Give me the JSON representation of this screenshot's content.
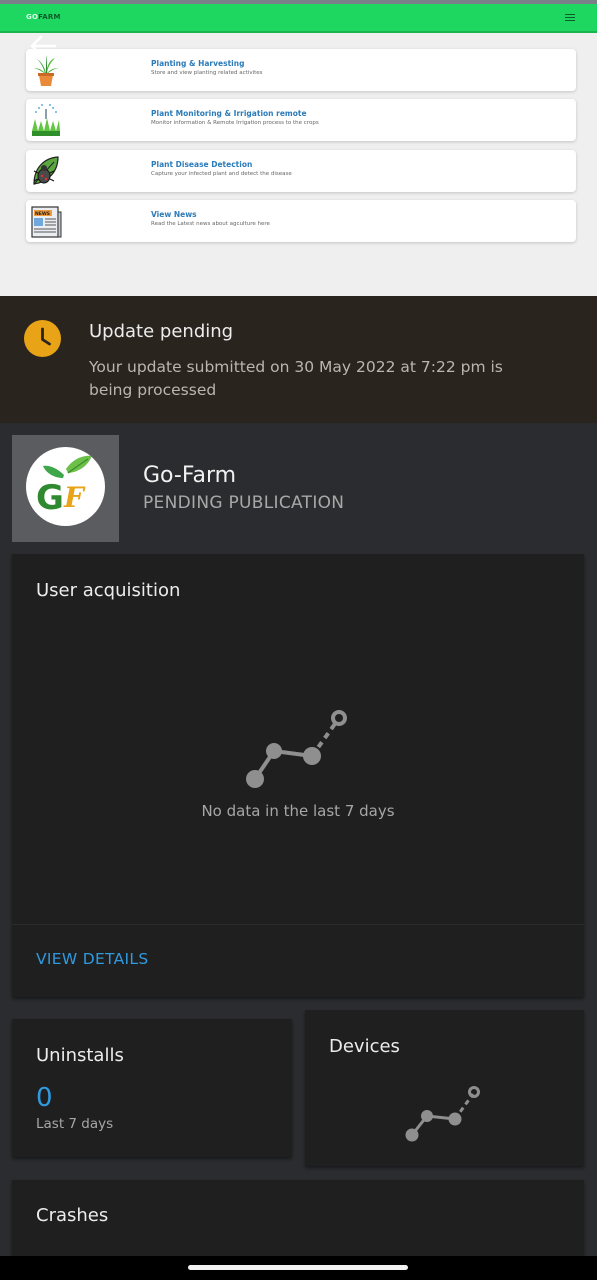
{
  "preview": {
    "logo_prefix": "GO",
    "logo_suffix": "FARM",
    "features": [
      {
        "title": "Planting & Harvesting",
        "desc": "Store and view planting related activites",
        "icon": "potted-plant-icon"
      },
      {
        "title": "Plant Monitoring & Irrigation remote",
        "desc": "Monitor information & Remote Irrigation process to the crops",
        "icon": "sprinkler-grass-icon"
      },
      {
        "title": "Plant Disease Detection",
        "desc": "Capture your infected plant and detect the disease",
        "icon": "leaf-bug-icon"
      },
      {
        "title": "View News",
        "desc": "Read the Latest news about agculture here",
        "icon": "newspaper-icon"
      }
    ]
  },
  "banner": {
    "title": "Update pending",
    "text": "Your update submitted on 30 May 2022 at 7:22 pm is being processed",
    "accent": "#e8a317"
  },
  "app": {
    "name": "Go-Farm",
    "status": "PENDING PUBLICATION",
    "icon_text": "GF"
  },
  "user_acquisition": {
    "title": "User acquisition",
    "empty_text": "No data in the last 7 days",
    "link": "VIEW DETAILS"
  },
  "uninstalls": {
    "title": "Uninstalls",
    "value": "0",
    "period": "Last 7 days"
  },
  "devices": {
    "title": "Devices"
  },
  "crashes": {
    "title": "Crashes"
  },
  "colors": {
    "link_blue": "#2f9ae0",
    "card_bg": "#1f1f1f",
    "page_bg": "#2b2c2f",
    "preview_green": "#1ed760"
  }
}
